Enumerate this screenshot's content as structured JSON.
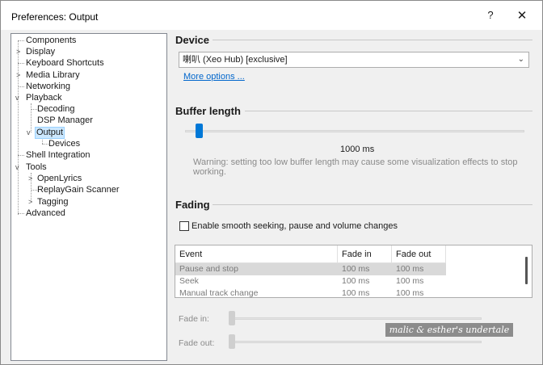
{
  "window": {
    "title": "Preferences: Output",
    "help_label": "?",
    "close_label": "✕"
  },
  "tree": {
    "items": [
      {
        "label": "Components"
      },
      {
        "label": "Display",
        "expander": ">"
      },
      {
        "label": "Keyboard Shortcuts"
      },
      {
        "label": "Media Library",
        "expander": ">"
      },
      {
        "label": "Networking"
      },
      {
        "label": "Playback",
        "expander": "v"
      },
      {
        "label": "Decoding"
      },
      {
        "label": "DSP Manager"
      },
      {
        "label": "Output",
        "expander": "v",
        "selected": true
      },
      {
        "label": "Devices"
      },
      {
        "label": "Shell Integration"
      },
      {
        "label": "Tools",
        "expander": "v"
      },
      {
        "label": "OpenLyrics",
        "expander": ">"
      },
      {
        "label": "ReplayGain Scanner"
      },
      {
        "label": "Tagging",
        "expander": ">"
      },
      {
        "label": "Advanced"
      }
    ]
  },
  "device": {
    "title": "Device",
    "selected": "喇叭 (Xeo Hub) [exclusive]",
    "more_options": "More options ..."
  },
  "buffer": {
    "title": "Buffer length",
    "value": "1000 ms",
    "warning": "Warning: setting too low buffer length may cause some visualization effects to stop working."
  },
  "fading": {
    "title": "Fading",
    "checkbox_label": "Enable smooth seeking, pause and volume changes",
    "checked": false,
    "columns": [
      "Event",
      "Fade in",
      "Fade out"
    ],
    "rows": [
      {
        "event": "Pause and stop",
        "fade_in": "100 ms",
        "fade_out": "100 ms"
      },
      {
        "event": "Seek",
        "fade_in": "100 ms",
        "fade_out": "100 ms"
      },
      {
        "event": "Manual track change",
        "fade_in": "100 ms",
        "fade_out": "100 ms"
      }
    ],
    "fade_in_label": "Fade in:",
    "fade_out_label": "Fade out:"
  },
  "watermark": "malic & esther's undertale",
  "colors": {
    "accent": "#0078d7",
    "link": "#0066cc",
    "selection": "#cce8ff"
  }
}
